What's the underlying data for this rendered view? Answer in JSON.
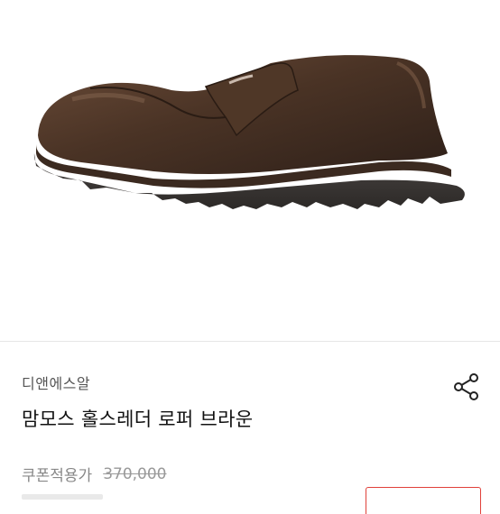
{
  "product": {
    "brand": "디앤에스알",
    "title": "맘모스 홀스레더 로퍼 브라운",
    "coupon_label": "쿠폰적용가",
    "original_price": "370,000"
  },
  "image": {
    "subject": "brown leather penny loafer with chunky lug sole",
    "background": "#ffffff"
  },
  "icons": {
    "share": "share-icon"
  },
  "colors": {
    "accent": "#e0413a",
    "leather": "#4a3325",
    "sole": "#3a3634"
  }
}
